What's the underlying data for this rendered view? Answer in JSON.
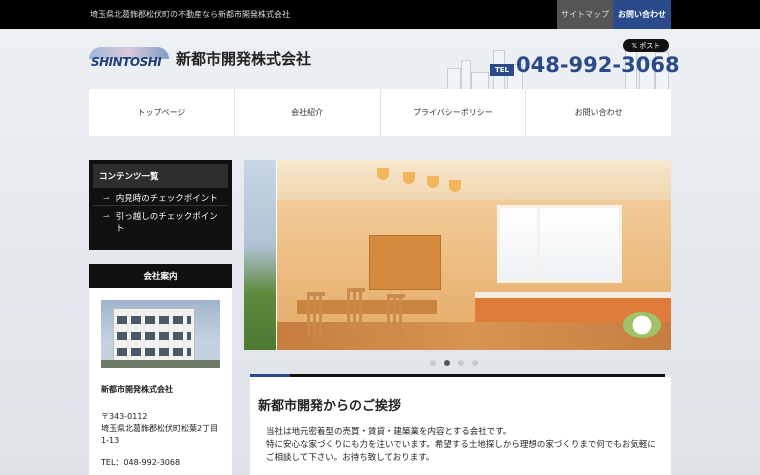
{
  "topbar": {
    "tagline": "埼玉県北葛飾郡松伏町の不動産なら新都市開発株式会社",
    "sitemap": "サイトマップ",
    "contact": "お問い合わせ"
  },
  "header": {
    "logo_text": "SHINTOSHI",
    "company_name": "新都市開発株式会社",
    "x_post": "ポスト",
    "tel_label": "TEL",
    "tel_number": "048-992-3068"
  },
  "nav": {
    "items": [
      {
        "label": "トップページ"
      },
      {
        "label": "会社紹介"
      },
      {
        "label": "プライバシーポリシー"
      },
      {
        "label": "お問い合わせ"
      }
    ]
  },
  "sidebar": {
    "contents_title": "コンテンツ一覧",
    "links": [
      {
        "label": "内見時のチェックポイント"
      },
      {
        "label": "引っ越しのチェックポイント"
      }
    ],
    "company_title": "会社案内",
    "company_name": "新都市開発株式会社",
    "postal": "〒343-0112",
    "address": "埼玉県北葛飾郡松伏町松葉2丁目1-13",
    "tel": "TEL：048-992-3068"
  },
  "slider": {
    "dots": 4,
    "active_index": 1
  },
  "greeting": {
    "title": "新都市開発からのご挨拶",
    "body_line1": "当社は地元密着型の売買・賃貸・建築業を内容とする会社です。",
    "body_line2": "特に安心な家づくりにも力を注いでいます。希望する土地探しから理想の家づくりまで何でもお気軽にご相談して下さい。お待ち致しております。"
  },
  "colors": {
    "accent": "#2b4a8b",
    "topbar": "#000000",
    "sidebar_dark": "#111111"
  }
}
